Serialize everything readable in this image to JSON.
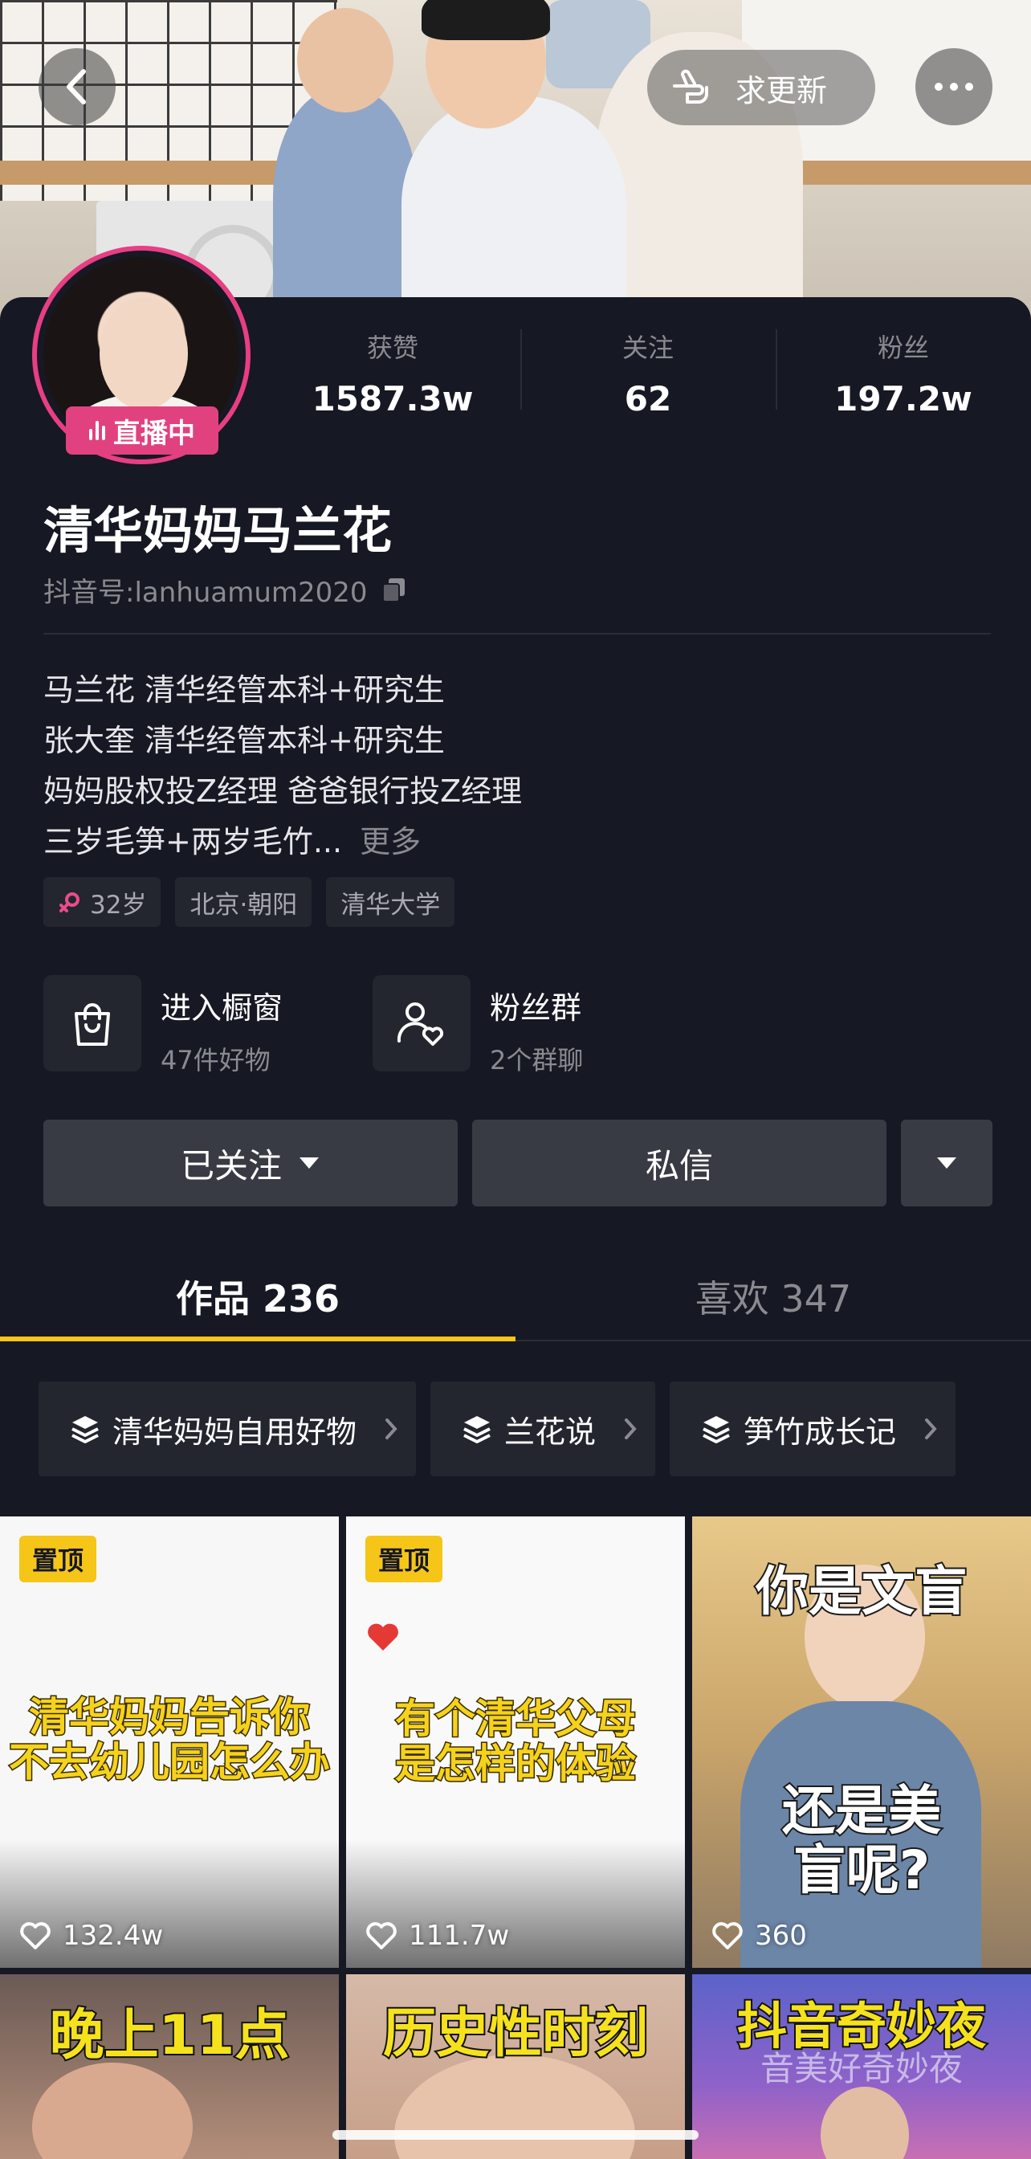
{
  "header": {
    "update_label": "求更新"
  },
  "profile": {
    "live_label": "直播中",
    "name": "清华妈妈马兰花",
    "douyin_id": "抖音号:lanhuamum2020",
    "stats": [
      {
        "label": "获赞",
        "value": "1587.3w"
      },
      {
        "label": "关注",
        "value": "62"
      },
      {
        "label": "粉丝",
        "value": "197.2w"
      }
    ],
    "bio_lines": [
      "马兰花 清华经管本科+研究生",
      "张大奎 清华经管本科+研究生",
      "妈妈股权投Z经理 爸爸银行投Z经理",
      "三岁毛笋+两岁毛竹..."
    ],
    "bio_more": "更多",
    "tags": [
      {
        "icon": "female-icon",
        "label": "32岁"
      },
      {
        "label": "北京·朝阳"
      },
      {
        "label": "清华大学"
      }
    ]
  },
  "features": {
    "shop": {
      "title": "进入橱窗",
      "subtitle": "47件好物"
    },
    "fans": {
      "title": "粉丝群",
      "subtitle": "2个群聊"
    }
  },
  "actions": {
    "follow_label": "已关注",
    "message_label": "私信"
  },
  "tabs": [
    {
      "label": "作品 236",
      "active": true
    },
    {
      "label": "喜欢 347",
      "active": false
    }
  ],
  "collections": [
    {
      "label": "清华妈妈自用好物"
    },
    {
      "label": "兰花说"
    },
    {
      "label": "笋竹成长记"
    }
  ],
  "videos": [
    {
      "pinned": "置顶",
      "caption": "清华妈妈告诉你\n不去幼儿园怎么办",
      "likes": "132.4w"
    },
    {
      "pinned": "置顶",
      "caption": "有个清华父母\n是怎样的体验",
      "likes": "111.7w"
    },
    {
      "caption_top": "你是文盲",
      "caption_bottom": "还是美\n盲呢?",
      "likes": "360"
    },
    {
      "caption": "晚上11点"
    },
    {
      "caption": "历史性时刻"
    },
    {
      "caption": "抖音奇妙夜",
      "sub": "音美好奇妙夜"
    }
  ],
  "colors": {
    "background": "#161823",
    "accent_yellow": "#f5c518",
    "live_pink": "#e2417f",
    "button_gray": "#393b44"
  }
}
